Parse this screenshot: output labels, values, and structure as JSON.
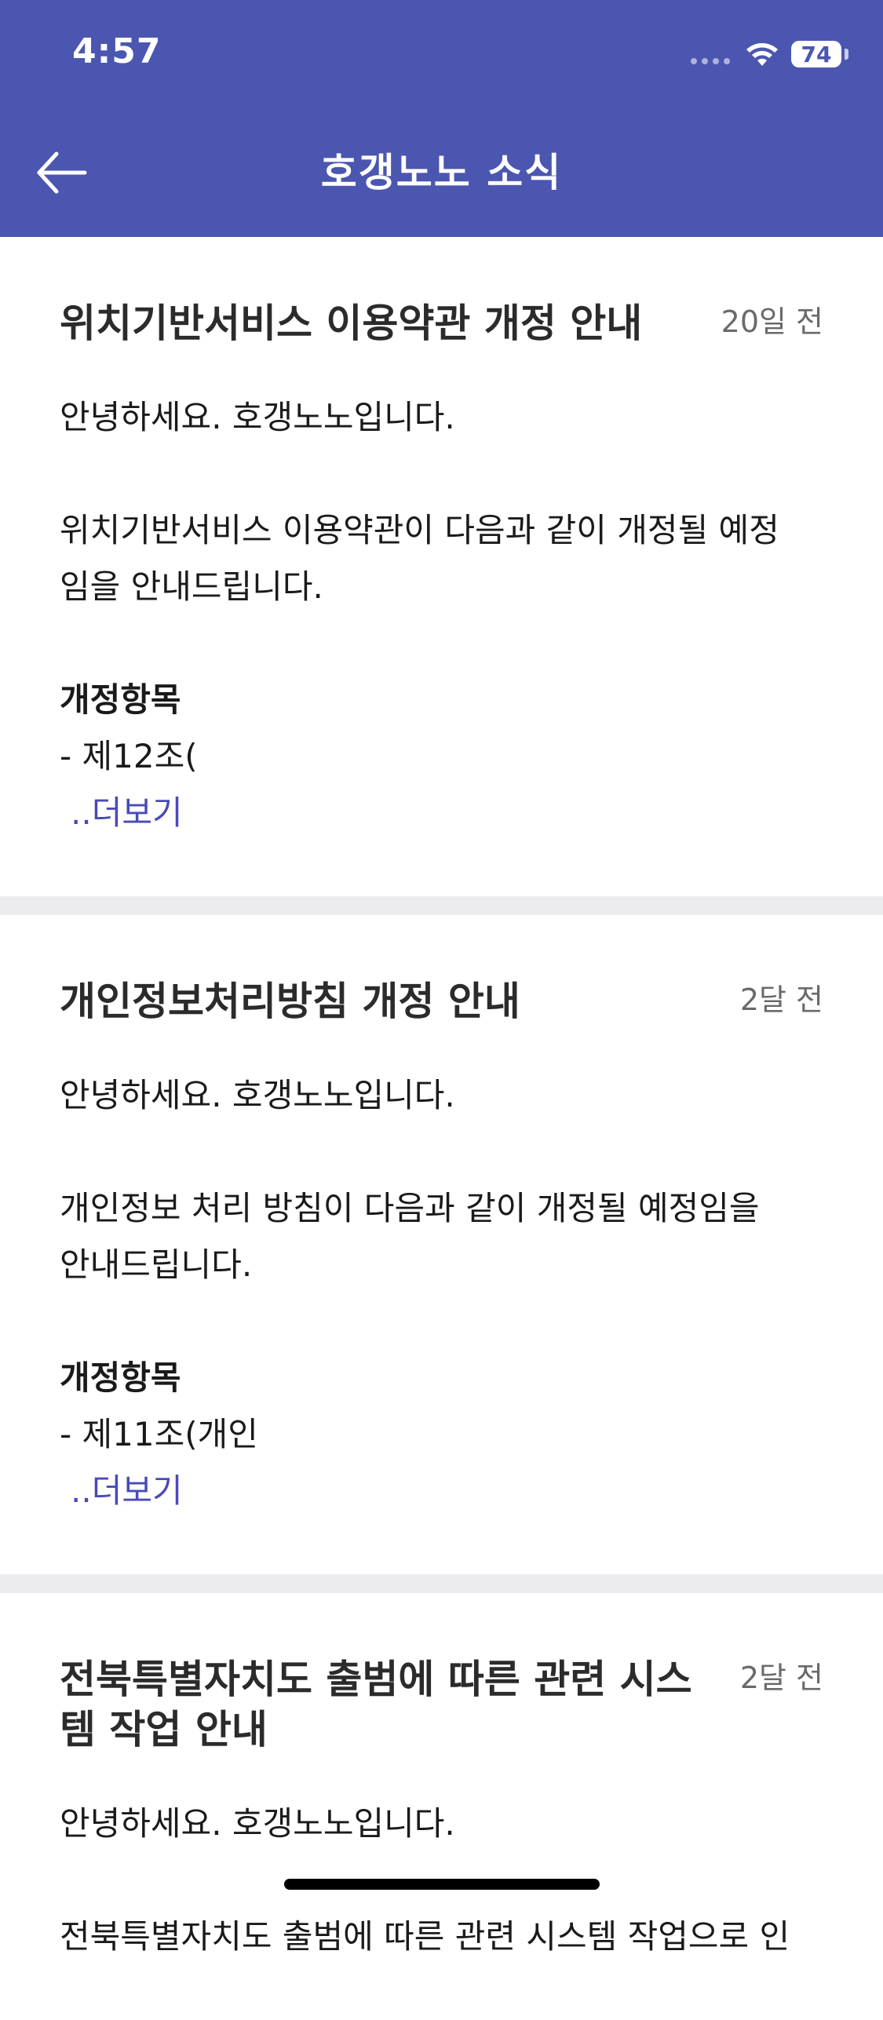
{
  "status_bar": {
    "time": "4:57",
    "battery": "74",
    "battery_level": 0.74,
    "signal_icon": "signal-dots-icon",
    "wifi_icon": "wifi-icon"
  },
  "header": {
    "title": "호갱노노 소식",
    "back_icon": "back-arrow-icon",
    "background": "#4b56b0"
  },
  "accent_link_color": "#4a4ab8",
  "posts": [
    {
      "title": "위치기반서비스 이용약관 개정 안내",
      "date": "20일 전",
      "greeting": "안녕하세요. 호갱노노입니다.",
      "intro_line1": "위치기반서비스 이용약관이 다음과 같이 개정될 예정",
      "intro_line2": "임을 안내드립니다.",
      "section_heading": "개정항목",
      "item": "- 제12조(",
      "more": "..더보기"
    },
    {
      "title": "개인정보처리방침 개정 안내",
      "date": "2달 전",
      "greeting": "안녕하세요. 호갱노노입니다.",
      "intro_line1": "개인정보 처리 방침이 다음과 같이 개정될 예정임을",
      "intro_line2": "안내드립니다.",
      "section_heading": "개정항목",
      "item": "- 제11조(개인",
      "more": "..더보기"
    },
    {
      "title": "전북특별자치도 출범에 따른 관련 시스템 작업 안내",
      "date": "2달 전",
      "greeting": "안녕하세요. 호갱노노입니다.",
      "intro_line1": "전북특별자치도 출범에 따른 관련 시스템 작업으로 인"
    }
  ]
}
